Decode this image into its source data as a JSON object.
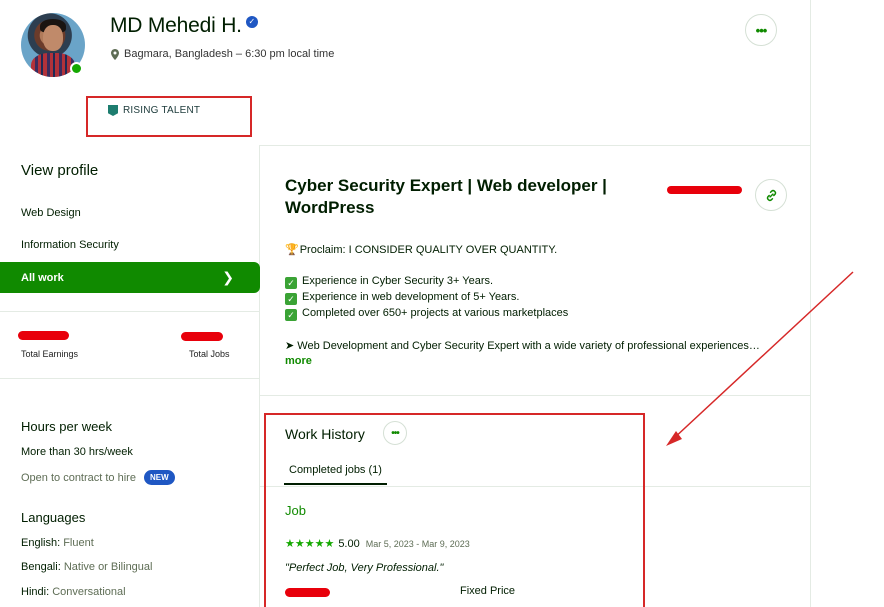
{
  "profile": {
    "name": "MD Mehedi H.",
    "location": "Bagmara, Bangladesh – 6:30 pm local time",
    "badge": "RISING TALENT"
  },
  "sidebar": {
    "view_profile": "View profile",
    "items": [
      {
        "label": "Web Design"
      },
      {
        "label": "Information Security"
      },
      {
        "label": "All work"
      }
    ],
    "stats": {
      "earnings_label": "Total Earnings",
      "jobs_label": "Total Jobs"
    },
    "hours": {
      "title": "Hours per week",
      "value": "More than 30 hrs/week",
      "open_contract": "Open to contract to hire",
      "new_badge": "NEW"
    },
    "languages": {
      "title": "Languages",
      "items": [
        {
          "name": "English:",
          "level": "Fluent"
        },
        {
          "name": "Bengali:",
          "level": "Native or Bilingual"
        },
        {
          "name": "Hindi:",
          "level": "Conversational"
        }
      ]
    }
  },
  "main": {
    "title": "Cyber Security Expert | Web developer | WordPress",
    "proclaim": "Proclaim: I CONSIDER QUALITY OVER QUANTITY.",
    "checks": [
      "Experience in Cyber Security 3+ Years.",
      "Experience in web development of 5+ Years.",
      "Completed over 650+ projects at various marketplaces"
    ],
    "summary": "➤ Web Development and Cyber Security Expert with a wide variety of professional experiences…",
    "more": "more"
  },
  "work_history": {
    "title": "Work History",
    "tab": "Completed jobs (1)",
    "job": {
      "title": "Job",
      "stars": "★★★★★",
      "rating": "5.00",
      "dates": "Mar 5, 2023 - Mar 9, 2023",
      "feedback": "\"Perfect Job, Very Professional.\"",
      "type": "Fixed Price"
    }
  },
  "colors": {
    "accent": "#108a00",
    "annotation": "#d62828",
    "redaction": "#e8000b",
    "badge_blue": "#1f57c3"
  },
  "icons": [
    "location-pin-icon",
    "verified-icon",
    "more-dots-icon",
    "rising-talent-flag-icon",
    "chevron-right-icon",
    "link-icon",
    "check-icon",
    "trophy-icon"
  ]
}
